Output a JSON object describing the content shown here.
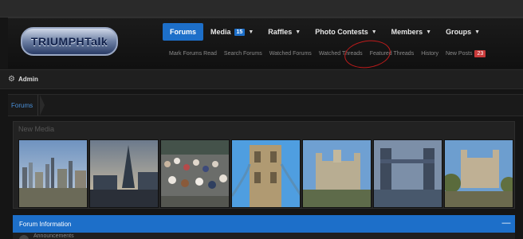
{
  "logo": {
    "text": "TRIUMPHTalk"
  },
  "nav": {
    "tabs": [
      {
        "label": "Forums",
        "active": true
      },
      {
        "label": "Media",
        "badge": "15"
      },
      {
        "label": "Raffles"
      },
      {
        "label": "Photo Contests"
      },
      {
        "label": "Members"
      },
      {
        "label": "Groups"
      }
    ]
  },
  "subnav": {
    "items": [
      "Mark Forums Read",
      "Search Forums",
      "Watched Forums",
      "Watched Threads",
      "Featured Threads",
      "History",
      "New Posts"
    ],
    "new_posts_badge": "23"
  },
  "admin": {
    "label": "Admin"
  },
  "breadcrumb": {
    "label": "Forums"
  },
  "media": {
    "title": "New Media",
    "thumbnails": [
      "london-skyline-thumbnail",
      "shard-skyline-thumbnail",
      "crowd-bridge-thumbnail",
      "tower-bridge-closeup-thumbnail",
      "tower-of-london-thumbnail",
      "tower-bridge-river-thumbnail",
      "tower-of-london-trees-thumbnail"
    ]
  },
  "forum_info": {
    "title": "Forum Information",
    "collapse_icon": "minus-icon"
  },
  "announcements": {
    "label": "Announcements"
  },
  "colors": {
    "accent": "#1d6fc9",
    "background": "#151515",
    "annotation": "#c01b1b",
    "badge_red": "#c93a3a"
  }
}
